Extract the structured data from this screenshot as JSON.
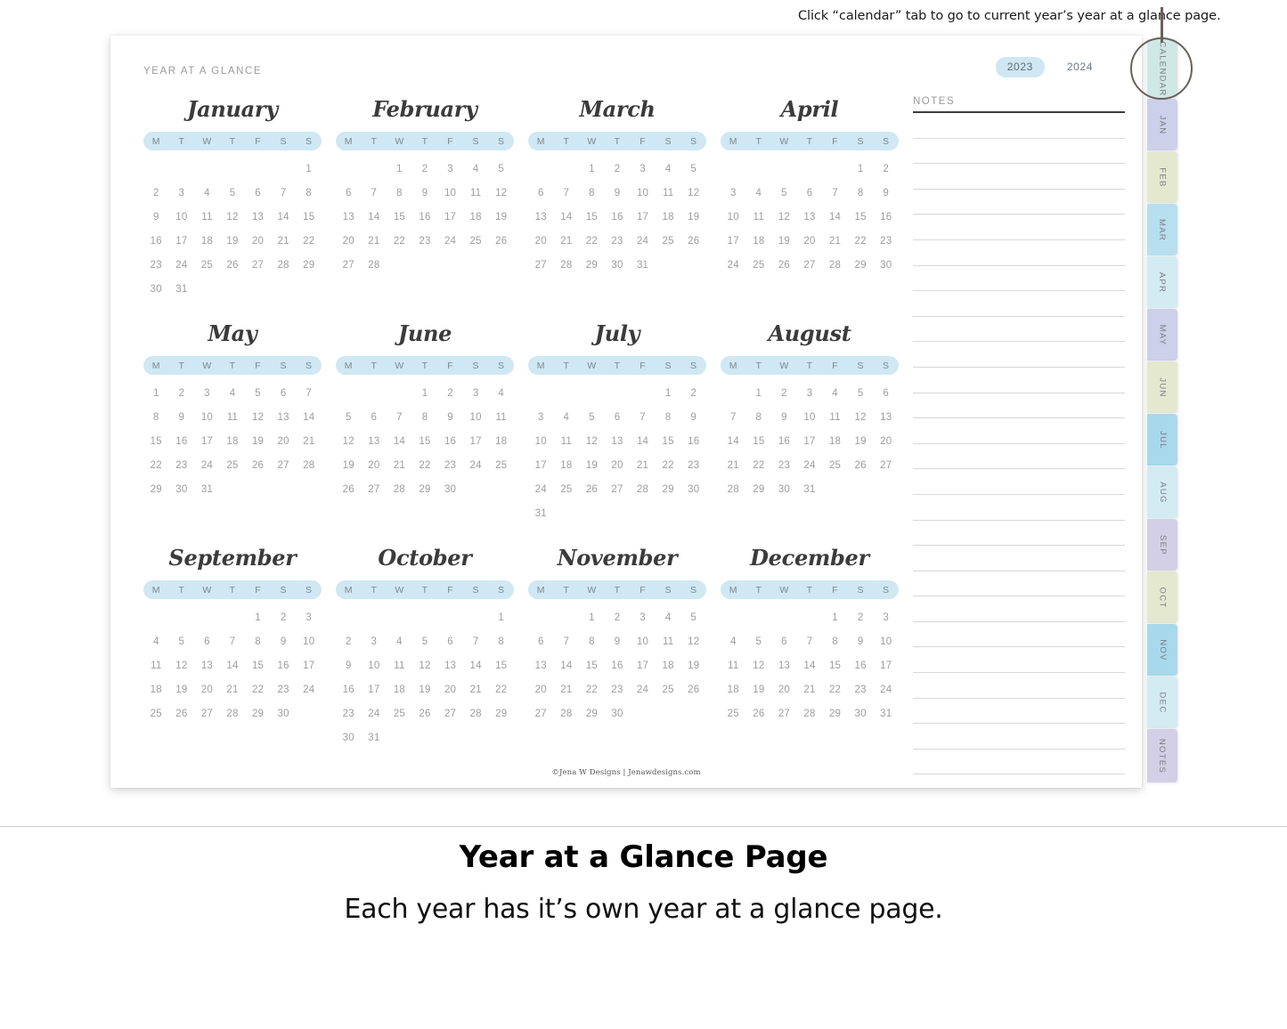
{
  "callout": {
    "text": "Click “calendar” tab to go to current year’s year at a glance page."
  },
  "page": {
    "kicker": "YEAR AT A GLANCE",
    "credit": "©Jena W Designs | Jenawdesigns.com"
  },
  "year_toggle": {
    "selected": "2023",
    "options": [
      {
        "label": "2023",
        "active": true
      },
      {
        "label": "2024",
        "active": false
      }
    ],
    "active_pill_color": "#cfe7f2"
  },
  "notes": {
    "title": "NOTES",
    "line_count": 26
  },
  "calendar": {
    "year": 2023,
    "dow": [
      "M",
      "T",
      "W",
      "T",
      "F",
      "S",
      "S"
    ],
    "dow_bar_color": "#cfe8f3",
    "months": [
      {
        "name": "January",
        "lead_blanks": 6,
        "days": 31
      },
      {
        "name": "February",
        "lead_blanks": 2,
        "days": 28
      },
      {
        "name": "March",
        "lead_blanks": 2,
        "days": 31
      },
      {
        "name": "April",
        "lead_blanks": 5,
        "days": 30
      },
      {
        "name": "May",
        "lead_blanks": 0,
        "days": 31
      },
      {
        "name": "June",
        "lead_blanks": 3,
        "days": 30
      },
      {
        "name": "July",
        "lead_blanks": 5,
        "days": 31
      },
      {
        "name": "August",
        "lead_blanks": 1,
        "days": 31
      },
      {
        "name": "September",
        "lead_blanks": 4,
        "days": 30
      },
      {
        "name": "October",
        "lead_blanks": 6,
        "days": 31
      },
      {
        "name": "November",
        "lead_blanks": 2,
        "days": 30
      },
      {
        "name": "December",
        "lead_blanks": 4,
        "days": 31
      }
    ]
  },
  "tabs": {
    "items": [
      {
        "label": "CALENDAR",
        "color": "#cfe8e6",
        "kind": "calendar"
      },
      {
        "label": "JAN",
        "color": "#ccd0ea"
      },
      {
        "label": "FEB",
        "color": "#e4e8cf"
      },
      {
        "label": "MAR",
        "color": "#b7dff0"
      },
      {
        "label": "APR",
        "color": "#d3ebf2"
      },
      {
        "label": "MAY",
        "color": "#ccd0ea"
      },
      {
        "label": "JUN",
        "color": "#e4e8cf"
      },
      {
        "label": "JUL",
        "color": "#a8d8ec"
      },
      {
        "label": "AUG",
        "color": "#d3ebf2"
      },
      {
        "label": "SEP",
        "color": "#d2cfe6"
      },
      {
        "label": "OCT",
        "color": "#e4e8cf"
      },
      {
        "label": "NOV",
        "color": "#a8d8ec"
      },
      {
        "label": "DEC",
        "color": "#d3ebf2"
      },
      {
        "label": "NOTES",
        "color": "#d2cfe6",
        "kind": "notes"
      }
    ]
  },
  "caption": {
    "title": "Year at a Glance Page",
    "subtitle": "Each year has it’s own year at a glance page."
  }
}
